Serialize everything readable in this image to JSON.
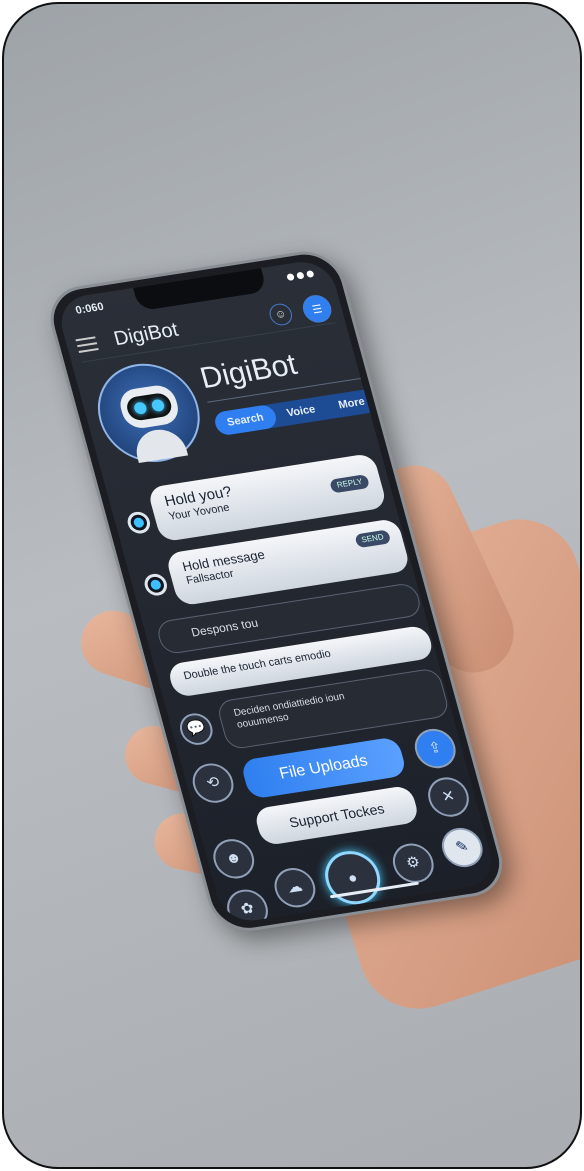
{
  "status": {
    "time": "0:060"
  },
  "header": {
    "title": "DigiBot",
    "icons": [
      "menu-icon",
      "smile-icon",
      "chat-icon"
    ]
  },
  "profile": {
    "name": "DigiBot",
    "pills": [
      "Search",
      "Voice",
      "More"
    ]
  },
  "messages": [
    {
      "line1": "Hold you?",
      "line2": "Your Yovone",
      "tag": "REPLY"
    },
    {
      "line1": "Hold message",
      "line2": "Fallsactor",
      "tag": "SEND"
    },
    {
      "text": "Despons tou"
    },
    {
      "text": "Double the touch carts emodio"
    },
    {
      "line1": "Deciden ondiattiedio ioun",
      "line2": "oouumenso"
    }
  ],
  "actions": {
    "file_uploads": "File Uploads",
    "support": "Support Tockes"
  },
  "colors": {
    "accent": "#2f7ff0",
    "glow": "#46c8ff"
  }
}
